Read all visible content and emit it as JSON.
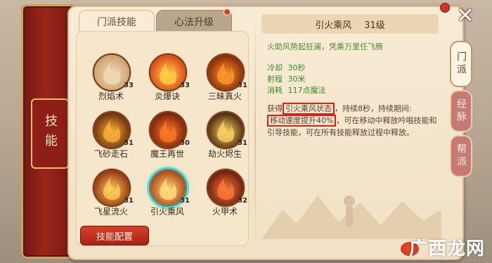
{
  "window": {
    "side_label": "技能",
    "close_glyph": "✕",
    "watermark": "广西龙网"
  },
  "tabs": [
    {
      "label": "门派技能",
      "active": true
    },
    {
      "label": "心法升级",
      "active": false,
      "has_badge": true
    }
  ],
  "skills": [
    {
      "name": "烈焰术",
      "level": "33",
      "icon": "fire-swirl-icon",
      "palette": [
        "#f0dcb8",
        "#c99a6a"
      ]
    },
    {
      "name": "炎爆诀",
      "level": "33",
      "icon": "flame-burst-icon",
      "palette": [
        "#ffd14a",
        "#d8360f"
      ]
    },
    {
      "name": "三昧真火",
      "level": "31",
      "icon": "triple-flame-icon",
      "palette": [
        "#ff9a2a",
        "#7a1a06"
      ]
    },
    {
      "name": "飞砂走石",
      "level": "31",
      "icon": "flying-rocks-icon",
      "palette": [
        "#ffb13a",
        "#5a2208"
      ]
    },
    {
      "name": "魔王再世",
      "level": "30",
      "icon": "demon-king-icon",
      "palette": [
        "#ff7a2a",
        "#6b1806"
      ]
    },
    {
      "name": "劫火烬生",
      "level": "31",
      "icon": "ember-rebirth-icon",
      "palette": [
        "#ffd466",
        "#3a1606"
      ]
    },
    {
      "name": "飞星流火",
      "level": "31",
      "icon": "meteor-fire-icon",
      "palette": [
        "#ffcf5a",
        "#8a2308"
      ]
    },
    {
      "name": "引火乘风",
      "level": "31",
      "icon": "wind-fire-icon",
      "palette": [
        "#ffe07a",
        "#a8320c"
      ],
      "selected": true
    },
    {
      "name": "火甲术",
      "level": "32",
      "icon": "fire-armor-icon",
      "palette": [
        "#ff7a3a",
        "#5a1206"
      ]
    }
  ],
  "config_button": "技能配置",
  "detail": {
    "skill_name": "引火乘风",
    "level_text": "31级",
    "flavor": "火助风势起狂澜，凭乘万里任飞腾",
    "stats": [
      {
        "label": "冷却",
        "value": "30秒"
      },
      {
        "label": "射程",
        "value": "30米"
      },
      {
        "label": "消耗",
        "value": "117点魔法"
      }
    ],
    "effect_prefix": "获得",
    "effect_buff": "引火乘风状态",
    "effect_duration": "，持续8秒，持续期间:",
    "effect_speed": "移动速度提升40%",
    "effect_rest_1": "，可在移动中释放吟唱技能和",
    "effect_rest_2": "引导技能，可在所有技能释放过程中释放。"
  },
  "side_tabs": [
    {
      "label": "门派",
      "active": true
    },
    {
      "label": "经脉",
      "active": false
    },
    {
      "label": "帮派",
      "active": false
    }
  ],
  "colors": {
    "accent_red": "#a92214",
    "highlight_border": "#e02016",
    "stat_green": "#3c8a2c",
    "selected_glow": "#6fd6c8"
  }
}
